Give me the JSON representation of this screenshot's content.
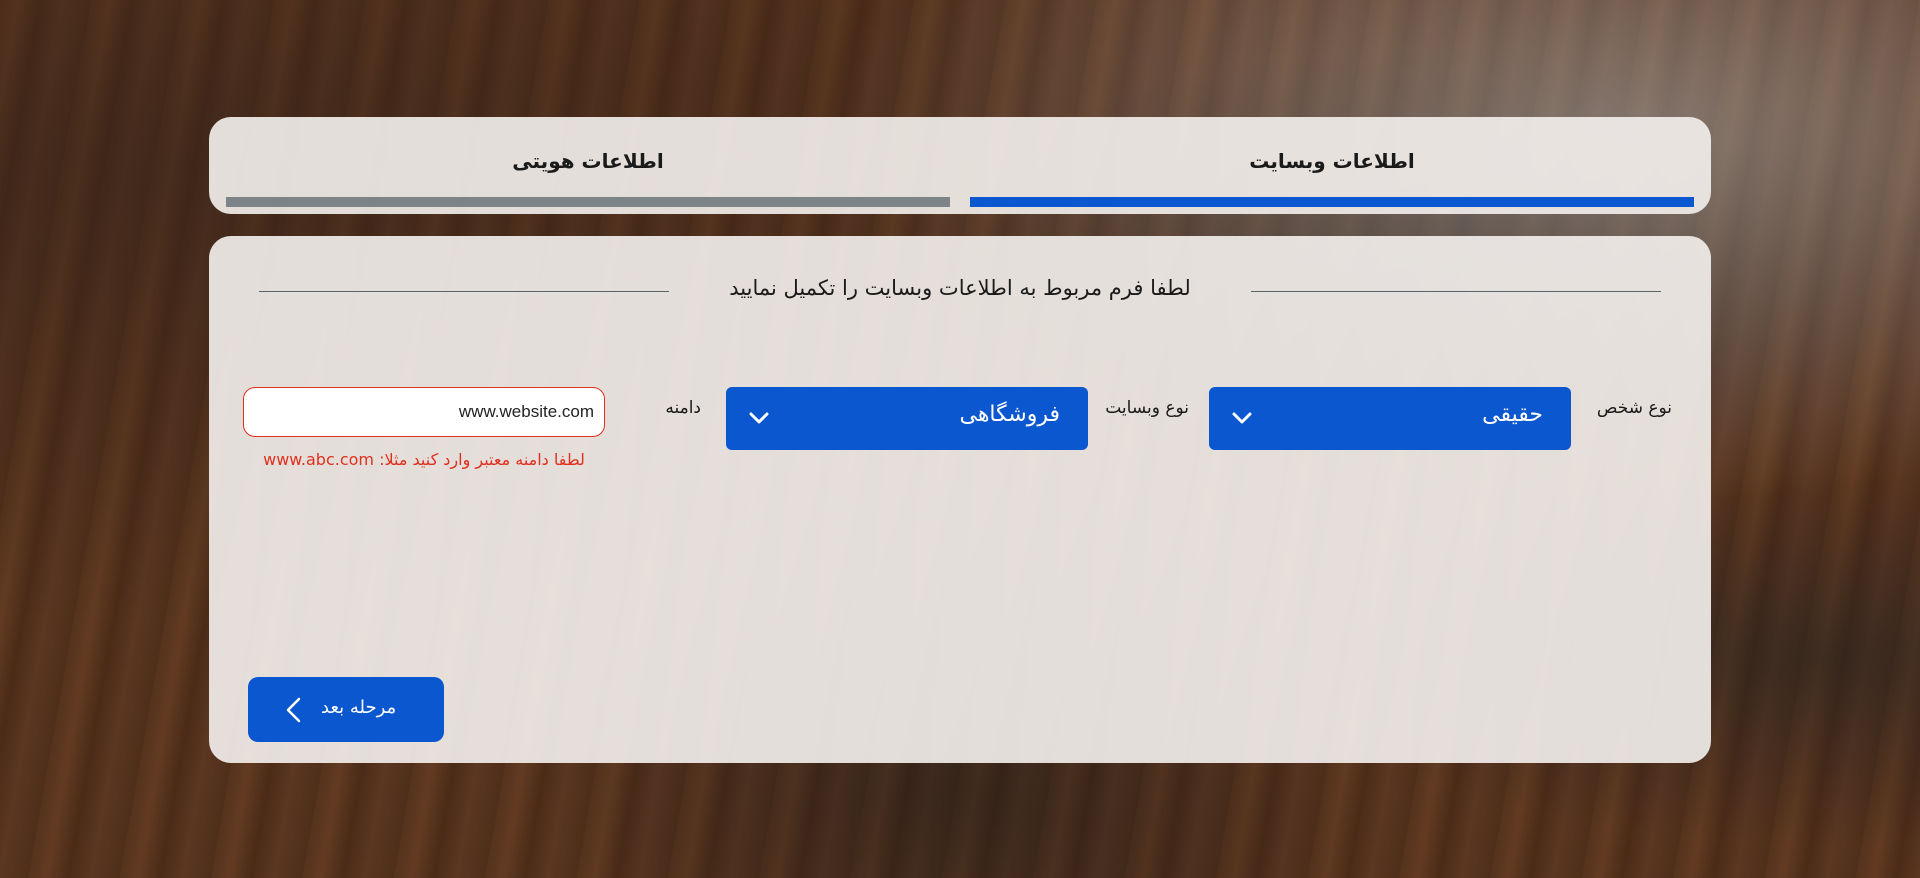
{
  "tabs": [
    {
      "label": "اطلاعات هویتی",
      "active": false
    },
    {
      "label": "اطلاعات وبسایت",
      "active": true
    }
  ],
  "form": {
    "header": "لطفا فرم مربوط به اطلاعات وبسایت را تکمیل نمایید",
    "person_type": {
      "label": "نوع شخص",
      "value": "حقیقی",
      "icon": "chevron-down-icon"
    },
    "site_type": {
      "label": "نوع وبسایت",
      "value": "فروشگاهی",
      "icon": "chevron-down-icon"
    },
    "domain": {
      "label": "دامنه",
      "value": "www.website.com",
      "error": "لطفا دامنه معتبر وارد کنید مثلا: www.abc.com"
    },
    "next_button": {
      "label": "مرحله بعد",
      "icon": "chevron-left-icon"
    }
  },
  "colors": {
    "primary": "#0b57d0",
    "inactive_tab_bar": "#7d8487",
    "error": "#e0301e",
    "panel": "#f0ece8"
  }
}
